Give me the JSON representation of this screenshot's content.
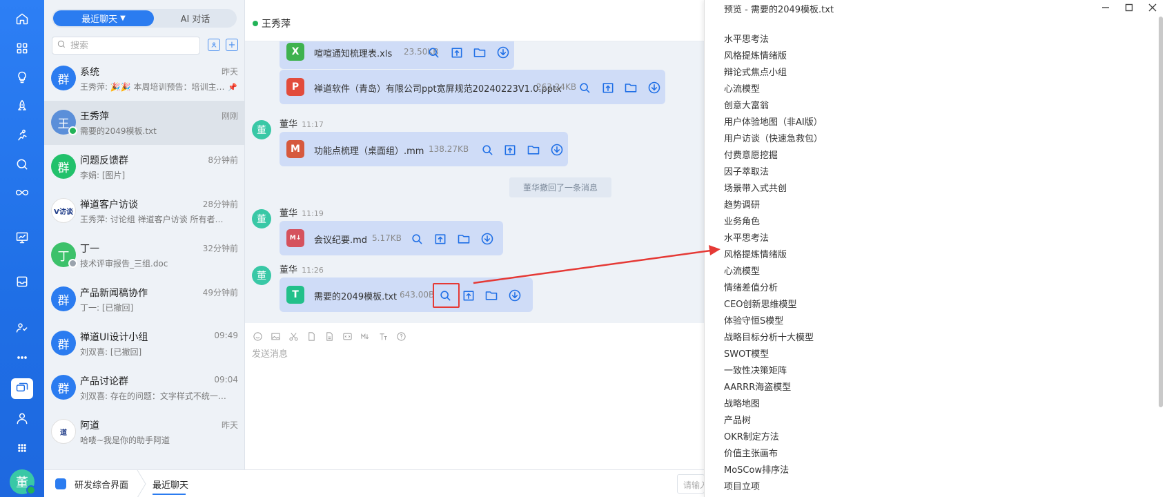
{
  "rail": {
    "icons": [
      "home-icon",
      "apps-icon",
      "bulb-icon",
      "rocket-icon",
      "run-icon",
      "search-icon",
      "infinity-icon",
      "board-icon",
      "inbox-icon",
      "users-icon",
      "more-icon",
      "chat-icon",
      "contact-icon",
      "grid-icon"
    ],
    "user_initial": "董"
  },
  "list": {
    "tab_recent": "最近聊天",
    "tab_ai": "AI 对话",
    "search_placeholder": "搜索",
    "conversations": [
      {
        "initial": "群",
        "name": "系统",
        "time": "昨天",
        "preview": "王秀萍: 🎉🎉 本周培训预告：培训主…",
        "color": "#2b7cf0"
      },
      {
        "initial": "王",
        "name": "王秀萍",
        "time": "刚刚",
        "preview": "需要的2049模板.txt",
        "color": "#5b8fd9"
      },
      {
        "initial": "群",
        "name": "问题反馈群",
        "time": "8分钟前",
        "preview": "李娟: [图片]",
        "color": "#22c16b"
      },
      {
        "initial": "V访谈",
        "name": "禅道客户访谈",
        "time": "28分钟前",
        "preview": "王秀萍: 讨论组 禅道客户访谈 所有者更…",
        "color": "#ffffff"
      },
      {
        "initial": "丁",
        "name": "丁一",
        "time": "32分钟前",
        "preview": "技术评审报告_三组.doc",
        "color": "#3cc16a"
      },
      {
        "initial": "群",
        "name": "产品新闻稿协作",
        "time": "49分钟前",
        "preview": "丁一: [已撤回]",
        "color": "#2b7cf0"
      },
      {
        "initial": "群",
        "name": "禅道UI设计小组",
        "time": "09:49",
        "preview": "刘双喜: [已撤回]",
        "color": "#2b7cf0"
      },
      {
        "initial": "群",
        "name": "产品讨论群",
        "time": "09:04",
        "preview": "刘双喜: 存在的问题：文字样式不统一；…",
        "color": "#2b7cf0"
      },
      {
        "initial": "道",
        "name": "阿道",
        "time": "昨天",
        "preview": "哈喽~我是你的助手阿道",
        "color": "#ffffff"
      }
    ]
  },
  "chat": {
    "title": "王秀萍",
    "files": [
      {
        "name": "喧喧通知梳理表.xls",
        "size": "23.50KB",
        "type": "X",
        "color": "#3fb24f"
      },
      {
        "name": "禅道软件（青岛）有限公司ppt宽屏规范20240223V1.0.pptx",
        "size": "263.24KB",
        "type": "P",
        "color": "#e24c3c"
      },
      {
        "name": "功能点梳理（桌面组）.mm",
        "size": "138.27KB",
        "type": "M",
        "color": "#d6593e"
      },
      {
        "name": "会议纪要.md",
        "size": "5.17KB",
        "type": "M↓",
        "color": "#d5525e"
      },
      {
        "name": "需要的2049模板.txt",
        "size": "643.00B",
        "type": "T",
        "color": "#22c08a"
      }
    ],
    "senders": [
      {
        "name": "董华",
        "time": "11:17",
        "initial": "董"
      },
      {
        "name": "董华",
        "time": "11:19",
        "initial": "董"
      },
      {
        "name": "董华",
        "time": "11:26",
        "initial": "董"
      }
    ],
    "recall": "董华撤回了一条消息",
    "compose_placeholder": "发送消息",
    "toolbar": [
      "emoji-icon",
      "image-icon",
      "scissors-icon",
      "file-icon",
      "doc-icon",
      "code-icon",
      "markdown-icon",
      "font-icon",
      "help-icon"
    ]
  },
  "bottom": {
    "tab1": "研发综合界面",
    "tab2": "最近聊天",
    "input_placeholder": "请输入"
  },
  "preview": {
    "title": "预览 - 需要的2049模板.txt",
    "lines": [
      "水平思考法",
      "风格提炼情绪版",
      "辩论式焦点小组",
      "心流模型",
      "创意大富翁",
      "用户体验地图（非AI版）",
      "用户访谈（快速急救包）",
      "付费意愿挖掘",
      "因子萃取法",
      "场景带入式共创",
      "趋势调研",
      "业务角色",
      "水平思考法",
      "风格提炼情绪版",
      "心流模型",
      "情绪差值分析",
      "CEO创新思维模型",
      "体验守恒S模型",
      "战略目标分析十大模型",
      "SWOT模型",
      "一致性决策矩阵",
      "AARRR海盗模型",
      "战略地图",
      "产品树",
      "OKR制定方法",
      "价值主张画布",
      "MoSCow排序法",
      "项目立项"
    ]
  },
  "colors": {
    "accent": "#1f6fe6",
    "highlight": "#e53935"
  }
}
